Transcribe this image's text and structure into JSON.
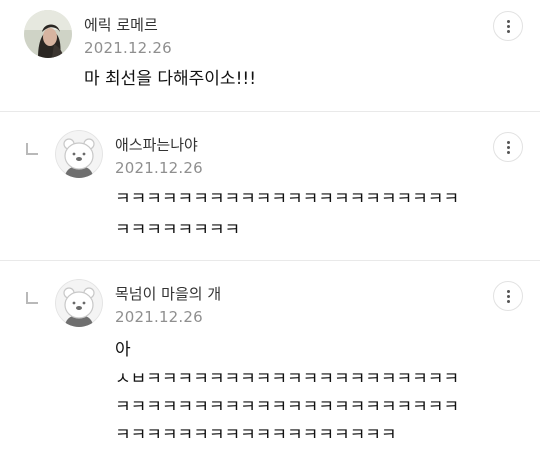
{
  "comments": [
    {
      "author": "에릭 로메르",
      "date": "2021.12.26",
      "lines": [
        "마 최선을 다해주이소!!!"
      ]
    },
    {
      "author": "애스파는나야",
      "date": "2021.12.26",
      "lines": [
        "ㅋㅋㅋㅋㅋㅋㅋㅋㅋㅋㅋㅋㅋㅋㅋㅋㅋㅋㅋㅋㅋㅋ",
        "ㅋㅋㅋㅋㅋㅋㅋㅋ"
      ]
    },
    {
      "author": "목넘이 마을의 개",
      "date": "2021.12.26",
      "lines": [
        "아",
        "ㅅㅂㅋㅋㅋㅋㅋㅋㅋㅋㅋㅋㅋㅋㅋㅋㅋㅋㅋㅋㅋㅋ",
        "ㅋㅋㅋㅋㅋㅋㅋㅋㅋㅋㅋㅋㅋㅋㅋㅋㅋㅋㅋㅋㅋㅋ",
        "ㅋㅋㅋㅋㅋㅋㅋㅋㅋㅋㅋㅋㅋㅋㅋㅋㅋㅋ"
      ]
    }
  ],
  "icons": {
    "more": "more-vertical-icon",
    "reply": "reply-arrow-icon",
    "default_avatar": "default-profile-icon"
  },
  "colors": {
    "author": "#333333",
    "date": "#8f8f8f",
    "body": "#111111",
    "divider": "#e9e9e9"
  }
}
